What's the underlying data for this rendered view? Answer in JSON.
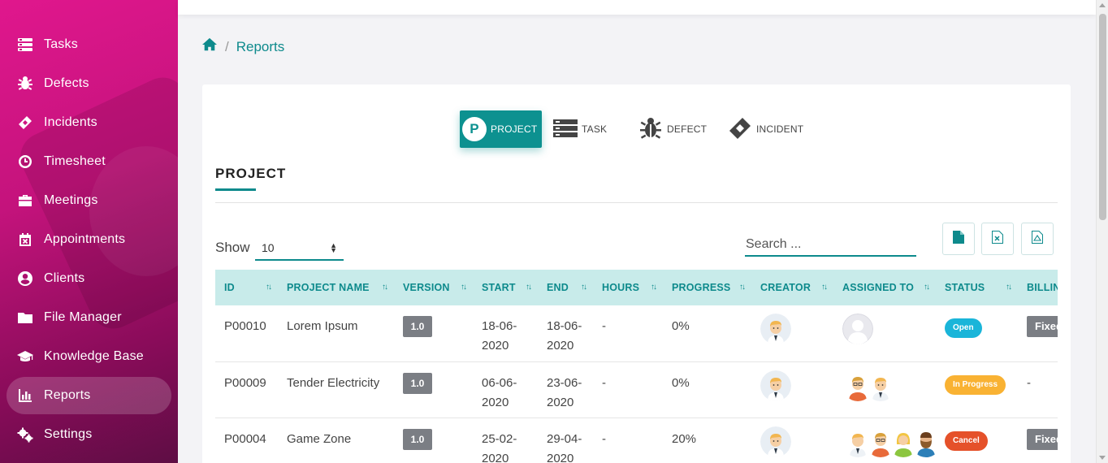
{
  "sidebar": {
    "items": [
      {
        "label": "Tasks",
        "icon": "tasks-icon"
      },
      {
        "label": "Defects",
        "icon": "bug-icon"
      },
      {
        "label": "Incidents",
        "icon": "ticket-icon"
      },
      {
        "label": "Timesheet",
        "icon": "clock-icon"
      },
      {
        "label": "Meetings",
        "icon": "briefcase-icon"
      },
      {
        "label": "Appointments",
        "icon": "calendar-x-icon"
      },
      {
        "label": "Clients",
        "icon": "user-circle-icon"
      },
      {
        "label": "File Manager",
        "icon": "folder-icon"
      },
      {
        "label": "Knowledge Base",
        "icon": "graduation-cap-icon"
      },
      {
        "label": "Reports",
        "icon": "bar-chart-icon",
        "active": true
      },
      {
        "label": "Settings",
        "icon": "gears-icon"
      }
    ]
  },
  "breadcrumb": {
    "home_icon": "home-icon",
    "separator": "/",
    "current": "Reports"
  },
  "report_tabs": [
    {
      "label": "PROJECT",
      "icon_letter": "P",
      "active": true
    },
    {
      "label": "TASK",
      "icon": "tasks-icon"
    },
    {
      "label": "DEFECT",
      "icon": "bug-icon"
    },
    {
      "label": "INCIDENT",
      "icon": "ticket-icon"
    }
  ],
  "section": {
    "title": "PROJECT"
  },
  "controls": {
    "show_label": "Show",
    "show_value": "10",
    "search_placeholder": "Search ...",
    "export_buttons": [
      "file-icon",
      "excel-icon",
      "pdf-icon"
    ]
  },
  "table": {
    "columns": [
      "ID",
      "PROJECT NAME",
      "VERSION",
      "START",
      "END",
      "HOURS",
      "PROGRESS",
      "CREATOR",
      "ASSIGNED TO",
      "STATUS",
      "BILLING"
    ],
    "rows": [
      {
        "id": "P00010",
        "name": "Lorem Ipsum",
        "version": "1.0",
        "start": "18-06-2020",
        "end": "18-06-2020",
        "hours": "-",
        "progress": "0%",
        "status": "Open",
        "billing": "Fixed"
      },
      {
        "id": "P00009",
        "name": "Tender Electricity",
        "version": "1.0",
        "start": "06-06-2020",
        "end": "23-06-2020",
        "hours": "-",
        "progress": "0%",
        "status": "In Progress",
        "billing": "-"
      },
      {
        "id": "P00004",
        "name": "Game Zone",
        "version": "1.0",
        "start": "25-02-2020",
        "end": "29-04-2020",
        "hours": "-",
        "progress": "20%",
        "status": "Cancel",
        "billing": "Fixed"
      }
    ]
  },
  "colors": {
    "accent": "#0d8a8c",
    "status_open": "#1ab5d9",
    "status_in_progress": "#f9b233",
    "status_cancel": "#e5512a",
    "sidebar_top": "#e0178d"
  }
}
